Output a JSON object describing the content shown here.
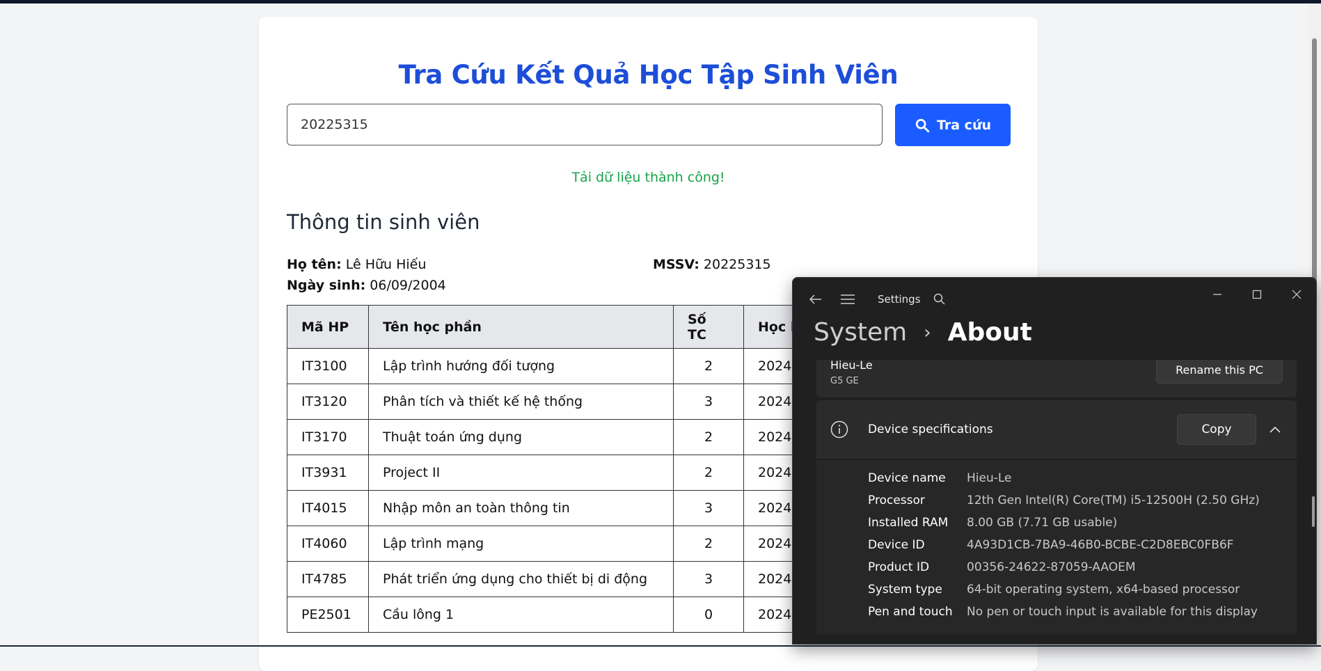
{
  "page": {
    "title": "Tra Cứu Kết Quả Học Tập Sinh Viên",
    "search": {
      "value": "20225315",
      "button_label": "Tra cứu"
    },
    "status_message": "Tải dữ liệu thành công!",
    "student_section_title": "Thông tin sinh viên",
    "student": {
      "name_label": "Họ tên:",
      "name": "Lê Hữu Hiếu",
      "id_label": "MSSV:",
      "id": "20225315",
      "dob_label": "Ngày sinh:",
      "dob": "06/09/2004"
    },
    "table": {
      "headers": [
        "Mã HP",
        "Tên học phần",
        "Số TC",
        "Học k"
      ],
      "rows": [
        [
          "IT3100",
          "Lập trình hướng đối tượng",
          "2",
          "2024"
        ],
        [
          "IT3120",
          "Phân tích và thiết kế hệ thống",
          "3",
          "2024"
        ],
        [
          "IT3170",
          "Thuật toán ứng dụng",
          "2",
          "2024"
        ],
        [
          "IT3931",
          "Project II",
          "2",
          "2024"
        ],
        [
          "IT4015",
          "Nhập môn an toàn thông tin",
          "3",
          "2024"
        ],
        [
          "IT4060",
          "Lập trình mạng",
          "2",
          "2024"
        ],
        [
          "IT4785",
          "Phát triển ứng dụng cho thiết bị di động",
          "3",
          "2024"
        ],
        [
          "PE2501",
          "Cầu lông 1",
          "0",
          "2024"
        ]
      ]
    },
    "colors": {
      "title": "#1d4ed8",
      "button": "#1a5cff",
      "success": "#16a34a"
    },
    "icons": {
      "search_button": "search-icon"
    }
  },
  "settings": {
    "app_title": "Settings",
    "breadcrumb": {
      "parent": "System",
      "current": "About"
    },
    "pc": {
      "name": "Hieu-Le",
      "model": "G5 GE",
      "rename_label": "Rename this PC"
    },
    "specs": {
      "title": "Device specifications",
      "copy_label": "Copy",
      "rows": [
        {
          "label": "Device name",
          "value": "Hieu-Le"
        },
        {
          "label": "Processor",
          "value": "12th Gen Intel(R) Core(TM) i5-12500H (2.50 GHz)"
        },
        {
          "label": "Installed RAM",
          "value": "8.00 GB (7.71 GB usable)"
        },
        {
          "label": "Device ID",
          "value": "4A93D1CB-7BA9-46B0-BCBE-C2D8EBC0FB6F"
        },
        {
          "label": "Product ID",
          "value": "00356-24622-87059-AAOEM"
        },
        {
          "label": "System type",
          "value": "64-bit operating system, x64-based processor"
        },
        {
          "label": "Pen and touch",
          "value": "No pen or touch input is available for this display"
        }
      ]
    },
    "icons": [
      "back-arrow-icon",
      "hamburger-menu-icon",
      "search-icon",
      "minimize-icon",
      "maximize-icon",
      "close-icon",
      "info-icon",
      "chevron-up-icon"
    ]
  }
}
